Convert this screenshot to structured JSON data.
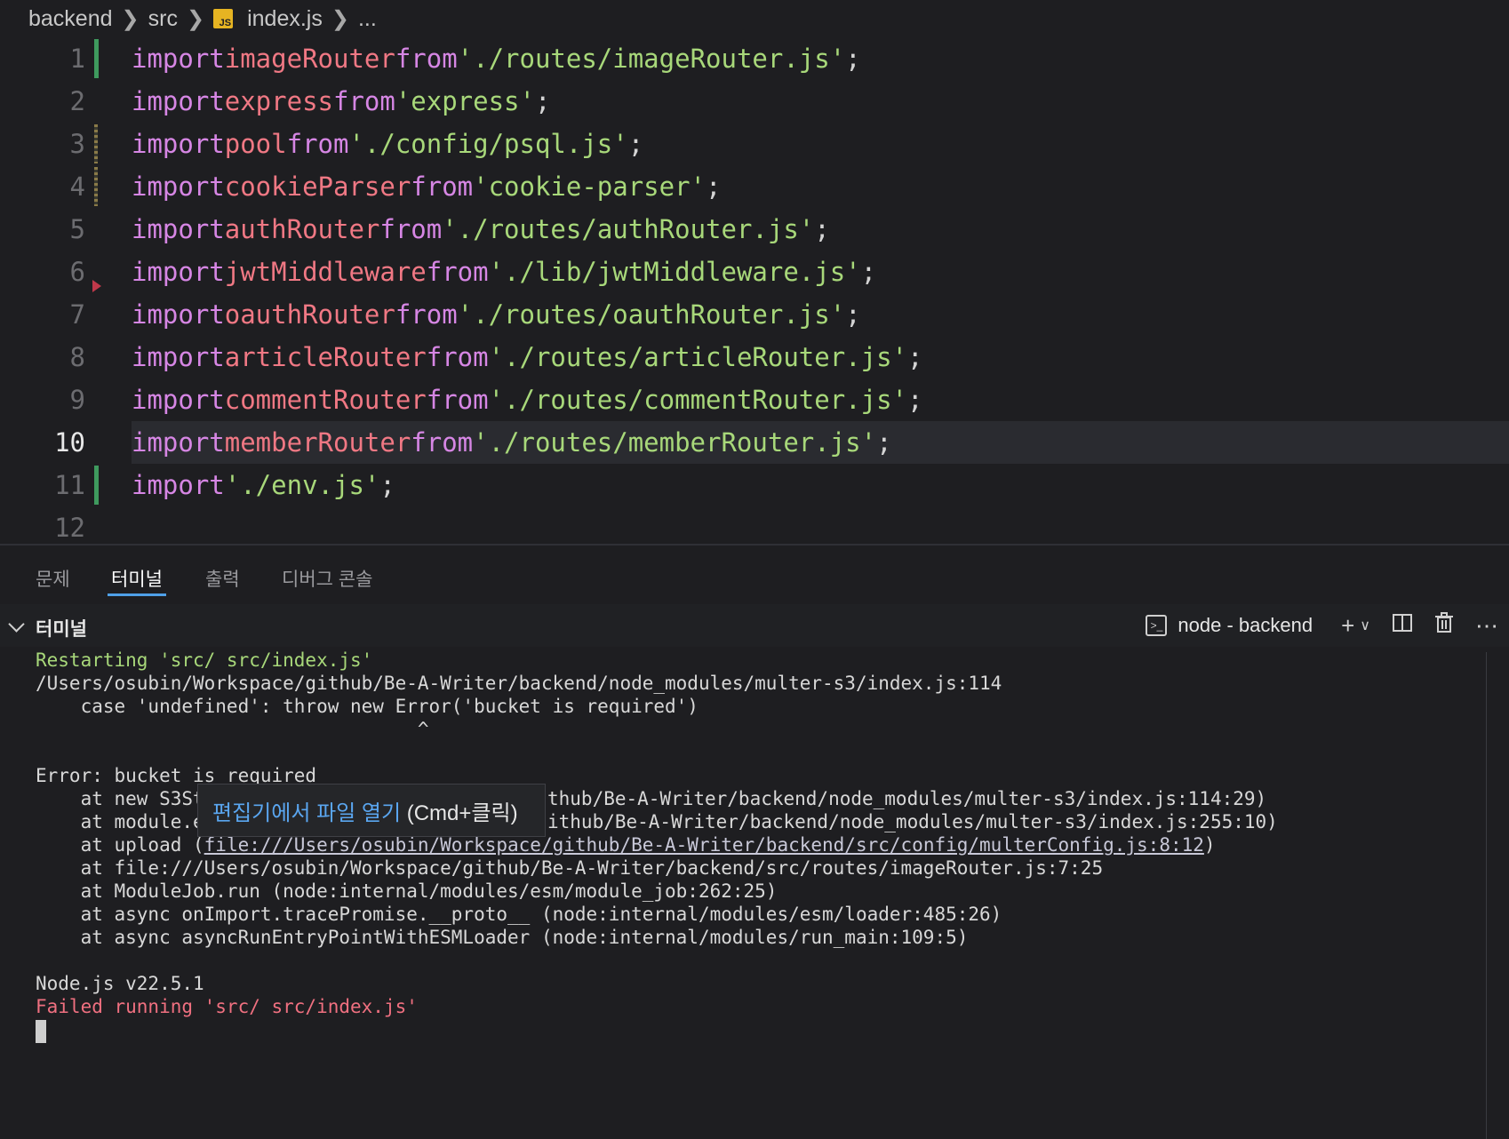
{
  "breadcrumb": {
    "part1": "backend",
    "part2": "src",
    "file_icon": "JS",
    "file": "index.js",
    "more": "..."
  },
  "editor": {
    "lines": [
      {
        "num": "1",
        "kw": "import",
        "id": "imageRouter",
        "from": "from",
        "str": "'./routes/imageRouter.js'",
        "end": ";"
      },
      {
        "num": "2",
        "kw": "import",
        "id": "express",
        "from": "from",
        "str": "'express'",
        "end": ";"
      },
      {
        "num": "3",
        "kw": "import",
        "id": "pool",
        "from": "from",
        "str": "'./config/psql.js'",
        "end": ";"
      },
      {
        "num": "4",
        "kw": "import",
        "id": "cookieParser",
        "from": "from",
        "str": "'cookie-parser'",
        "end": ";"
      },
      {
        "num": "5",
        "kw": "import",
        "id": "authRouter",
        "from": "from",
        "str": "'./routes/authRouter.js'",
        "end": ";"
      },
      {
        "num": "6",
        "kw": "import",
        "id": "jwtMiddleware",
        "from": "from",
        "str": "'./lib/jwtMiddleware.js'",
        "end": ";"
      },
      {
        "num": "7",
        "kw": "import",
        "id": "oauthRouter",
        "from": "from",
        "str": "'./routes/oauthRouter.js'",
        "end": ";"
      },
      {
        "num": "8",
        "kw": "import",
        "id": "articleRouter",
        "from": "from",
        "str": "'./routes/articleRouter.js'",
        "end": ";"
      },
      {
        "num": "9",
        "kw": "import",
        "id": "commentRouter",
        "from": "from",
        "str": "'./routes/commentRouter.js'",
        "end": ";"
      },
      {
        "num": "10",
        "kw": "import",
        "id": "memberRouter",
        "from": "from",
        "str": "'./routes/memberRouter.js'",
        "end": ";"
      },
      {
        "num": "11",
        "kw": "import",
        "id": "",
        "from": "",
        "str": "'./env.js'",
        "end": ";"
      },
      {
        "num": "12",
        "kw": "",
        "id": "",
        "from": "",
        "str": "",
        "end": ""
      }
    ]
  },
  "panel": {
    "tabs": [
      "문제",
      "터미널",
      "출력",
      "디버그 콘솔"
    ],
    "active_tab": "터미널",
    "terminal_title": "터미널",
    "terminal_name": "node - backend"
  },
  "terminal": {
    "l1": "Restarting 'src/ src/index.js'",
    "l2": "/Users/osubin/Workspace/github/Be-A-Writer/backend/node_modules/multer-s3/index.js:114",
    "l3": "    case 'undefined': throw new Error('bucket is required')",
    "l4": "                                  ^",
    "l5": "Error: bucket is required",
    "l6a": "    at new S3St",
    "l6b": "thub/Be-A-Writer/backend/node_modules/multer-s3/index.js:114:29)",
    "l7a": "    at module.e",
    "l7b": "ithub/Be-A-Writer/backend/node_modules/multer-s3/index.js:255:10)",
    "l8a": "    at upload (",
    "l8b": "file:///Users/osubin/Workspace/github/Be-A-Writer/backend/src/config/multerConfig.js:8:12",
    "l8c": ")",
    "l9": "    at file:///Users/osubin/Workspace/github/Be-A-Writer/backend/src/routes/imageRouter.js:7:25",
    "l10": "    at ModuleJob.run (node:internal/modules/esm/module_job:262:25)",
    "l11": "    at async onImport.tracePromise.__proto__ (node:internal/modules/esm/loader:485:26)",
    "l12": "    at async asyncRunEntryPointWithESMLoader (node:internal/modules/run_main:109:5)",
    "l13": "Node.js v22.5.1",
    "l14": "Failed running 'src/ src/index.js'"
  },
  "tooltip": {
    "link": "편집기에서 파일 열기",
    "hint": " (Cmd+클릭)"
  },
  "colors": {
    "keyword": "#d686e4",
    "identifier": "#f07884",
    "string": "#a8d87a",
    "accent": "#4fa0e8",
    "error": "#f07080"
  }
}
